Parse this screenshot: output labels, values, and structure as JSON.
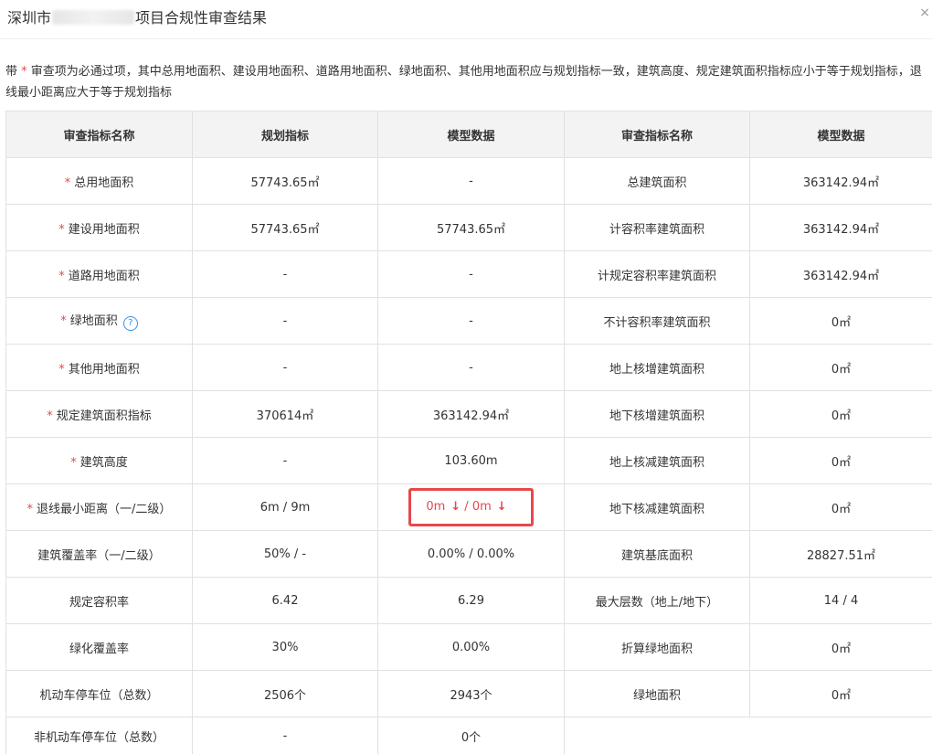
{
  "dialog": {
    "title_prefix": "深圳市",
    "title_suffix": "项目合规性审查结果",
    "close_symbol": "×"
  },
  "notice": {
    "lead": "带",
    "star": "*",
    "text": " 审查项为必通过项，其中总用地面积、建设用地面积、道路用地面积、绿地面积、其他用地面积应与规划指标一致，建筑高度、规定建筑面积指标应小于等于规划指标，退线最小距离应大于等于规划指标"
  },
  "table": {
    "headers": [
      "审查指标名称",
      "规划指标",
      "模型数据",
      "审查指标名称",
      "模型数据"
    ],
    "star": "*",
    "rows": [
      {
        "name": "总用地面积",
        "plan": "57743.65㎡",
        "model": "-",
        "name2": "总建筑面积",
        "model2": "363142.94㎡"
      },
      {
        "name": "建设用地面积",
        "plan": "57743.65㎡",
        "model": "57743.65㎡",
        "name2": "计容积率建筑面积",
        "model2": "363142.94㎡"
      },
      {
        "name": "道路用地面积",
        "plan": "-",
        "model": "-",
        "name2": "计规定容积率建筑面积",
        "model2": "363142.94㎡"
      },
      {
        "name": "绿地面积",
        "plan": "-",
        "model": "-",
        "name2": "不计容积率建筑面积",
        "model2": "0㎡"
      },
      {
        "name": "其他用地面积",
        "plan": "-",
        "model": "-",
        "name2": "地上核增建筑面积",
        "model2": "0㎡"
      },
      {
        "name": "规定建筑面积指标",
        "plan": "370614㎡",
        "model": "363142.94㎡",
        "name2": "地下核增建筑面积",
        "model2": "0㎡"
      },
      {
        "name": "建筑高度",
        "plan": "-",
        "model": "103.60m",
        "name2": "地上核减建筑面积",
        "model2": "0㎡"
      },
      {
        "name": "退线最小距离（一/二级）",
        "plan": "6m / 9m",
        "model_a": "0m",
        "model_sep": " / ",
        "model_b": "0m",
        "arrow": "↓",
        "name2": "地下核减建筑面积",
        "model2": "0㎡"
      },
      {
        "name": "建筑覆盖率（一/二级）",
        "plan": "50% / -",
        "model": "0.00% / 0.00%",
        "name2": "建筑基底面积",
        "model2": "28827.51㎡"
      },
      {
        "name": "规定容积率",
        "plan": "6.42",
        "model": "6.29",
        "name2": "最大层数（地上/地下）",
        "model2": "14 / 4"
      },
      {
        "name": "绿化覆盖率",
        "plan": "30%",
        "model": "0.00%",
        "name2": "折算绿地面积",
        "model2": "0㎡"
      },
      {
        "name": "机动车停车位（总数）",
        "plan": "2506个",
        "model": "2943个",
        "name2": "绿地面积",
        "model2": "0㎡"
      },
      {
        "name": "非机动车停车位（总数）",
        "plan": "-",
        "model": "0个"
      }
    ]
  },
  "help_icon_symbol": "?",
  "colors": {
    "required_star": "#e5484d",
    "warning": "#e5484d",
    "header_bg": "#f3f3f3",
    "help_icon": "#3a8ee6"
  }
}
